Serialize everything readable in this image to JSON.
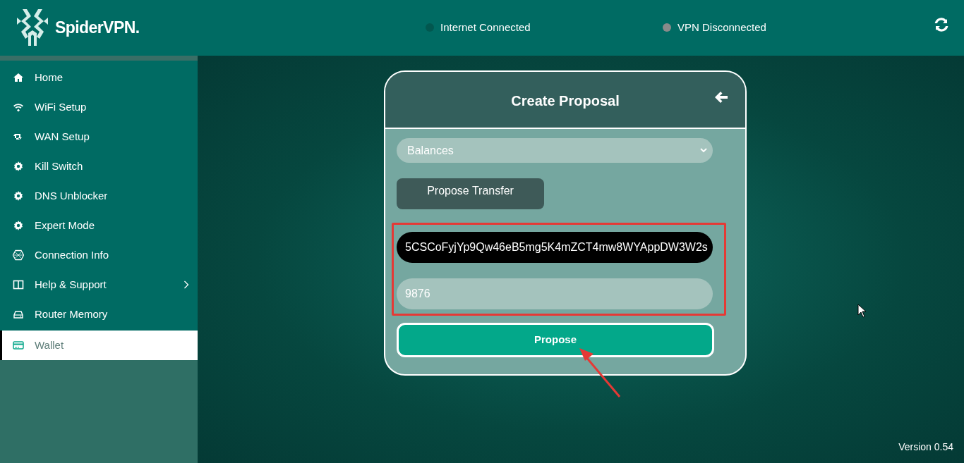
{
  "header": {
    "brand": "SpiderVPN.",
    "statuses": [
      {
        "label": "Internet Connected",
        "color": "#02574f"
      },
      {
        "label": "VPN Disconnected",
        "color": "#8a8a8a"
      }
    ]
  },
  "sidebar": {
    "items": [
      {
        "label": "Home",
        "kind": "home",
        "selected": false
      },
      {
        "label": "WiFi Setup",
        "kind": "wifi",
        "selected": false
      },
      {
        "label": "WAN Setup",
        "kind": "retweet",
        "selected": false
      },
      {
        "label": "Kill Switch",
        "kind": "gear",
        "selected": false
      },
      {
        "label": "DNS Unblocker",
        "kind": "gear",
        "selected": false
      },
      {
        "label": "Expert Mode",
        "kind": "gear",
        "selected": false
      },
      {
        "label": "Connection Info",
        "kind": "hex",
        "selected": false
      },
      {
        "label": "Help & Support",
        "kind": "columns",
        "selected": false,
        "submenu": true
      },
      {
        "label": "Router Memory",
        "kind": "drive",
        "selected": false
      },
      {
        "label": "Wallet",
        "kind": "card",
        "selected": true
      }
    ]
  },
  "card": {
    "title": "Create Proposal",
    "select": {
      "value": "Balances"
    },
    "tab_button": "Propose Transfer",
    "address": {
      "value": "5CSCoFyjYp9Qw46eB5mg5K4mZCT4mw8WYAppDW3W2s"
    },
    "amount": {
      "value": "9876"
    },
    "submit": "Propose"
  },
  "version": "Version 0.54"
}
